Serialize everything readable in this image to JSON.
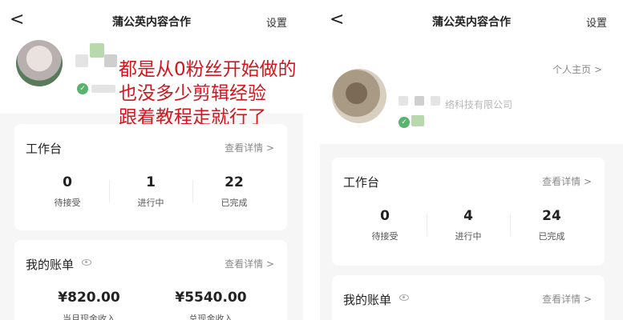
{
  "left": {
    "nav": {
      "back": "<",
      "title": "蒲公英内容合作",
      "settings": "设置"
    },
    "overlay": {
      "lines": [
        "都是从0粉丝开始做的",
        "也没多少剪辑经验",
        "跟着教程走就行了"
      ]
    },
    "workbench": {
      "title": "工作台",
      "link": "查看详情 >",
      "stats": [
        {
          "value": "0",
          "label": "待接受"
        },
        {
          "value": "1",
          "label": "进行中"
        },
        {
          "value": "22",
          "label": "已完成"
        }
      ]
    },
    "bill": {
      "title": "我的账单",
      "link": "查看详情 >",
      "items": [
        {
          "amount": "¥820.00",
          "label": "当月现金收入"
        },
        {
          "amount": "¥5540.00",
          "label": "总现金收入"
        }
      ]
    }
  },
  "right": {
    "nav": {
      "back": "<",
      "title": "蒲公英内容合作",
      "settings": "设置"
    },
    "profile": {
      "homepage": "个人主页 >",
      "company": "络科技有限公司"
    },
    "workbench": {
      "title": "工作台",
      "link": "查看详情 >",
      "stats": [
        {
          "value": "0",
          "label": "待接受"
        },
        {
          "value": "4",
          "label": "进行中"
        },
        {
          "value": "24",
          "label": "已完成"
        }
      ]
    },
    "bill": {
      "title": "我的账单",
      "link": "查看详情 >"
    }
  },
  "colors": {
    "accent_red": "#d4161c",
    "badge_green": "#59b36d",
    "bg": "#f6f6f6"
  },
  "icons": {
    "back": "chevron-left-icon",
    "verified": "verified-badge-icon",
    "eye": "eye-icon"
  }
}
